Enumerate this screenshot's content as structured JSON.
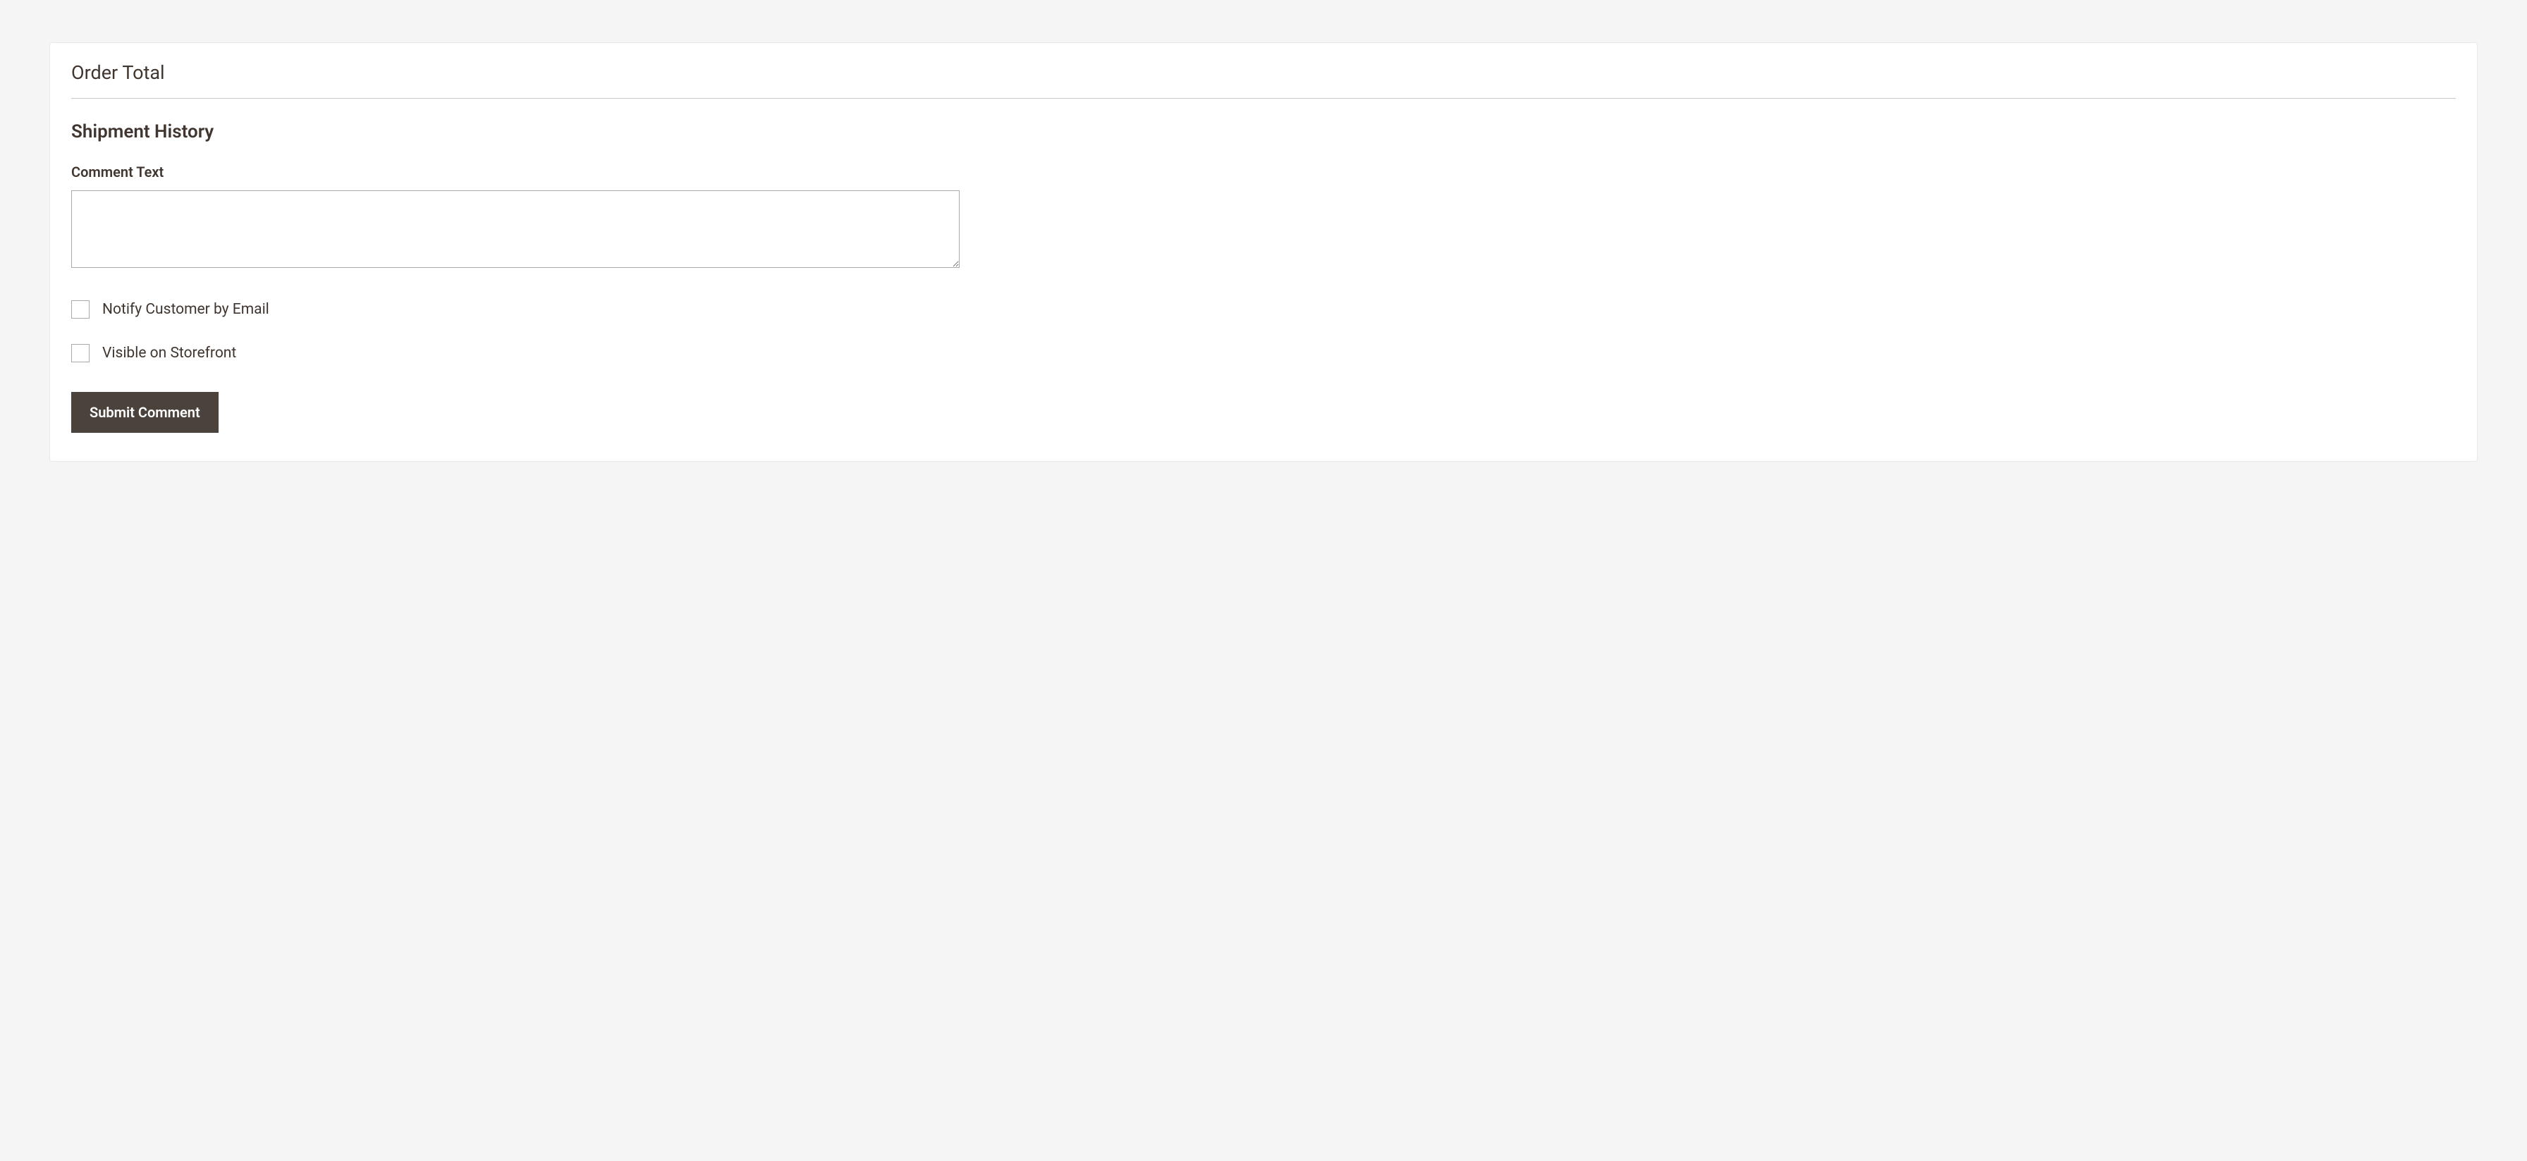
{
  "panel": {
    "section_title": "Order Total",
    "subsection_title": "Shipment History",
    "comment": {
      "label": "Comment Text",
      "value": ""
    },
    "notify_checkbox": {
      "label": "Notify Customer by Email",
      "checked": false
    },
    "visible_checkbox": {
      "label": "Visible on Storefront",
      "checked": false
    },
    "submit_label": "Submit Comment"
  }
}
